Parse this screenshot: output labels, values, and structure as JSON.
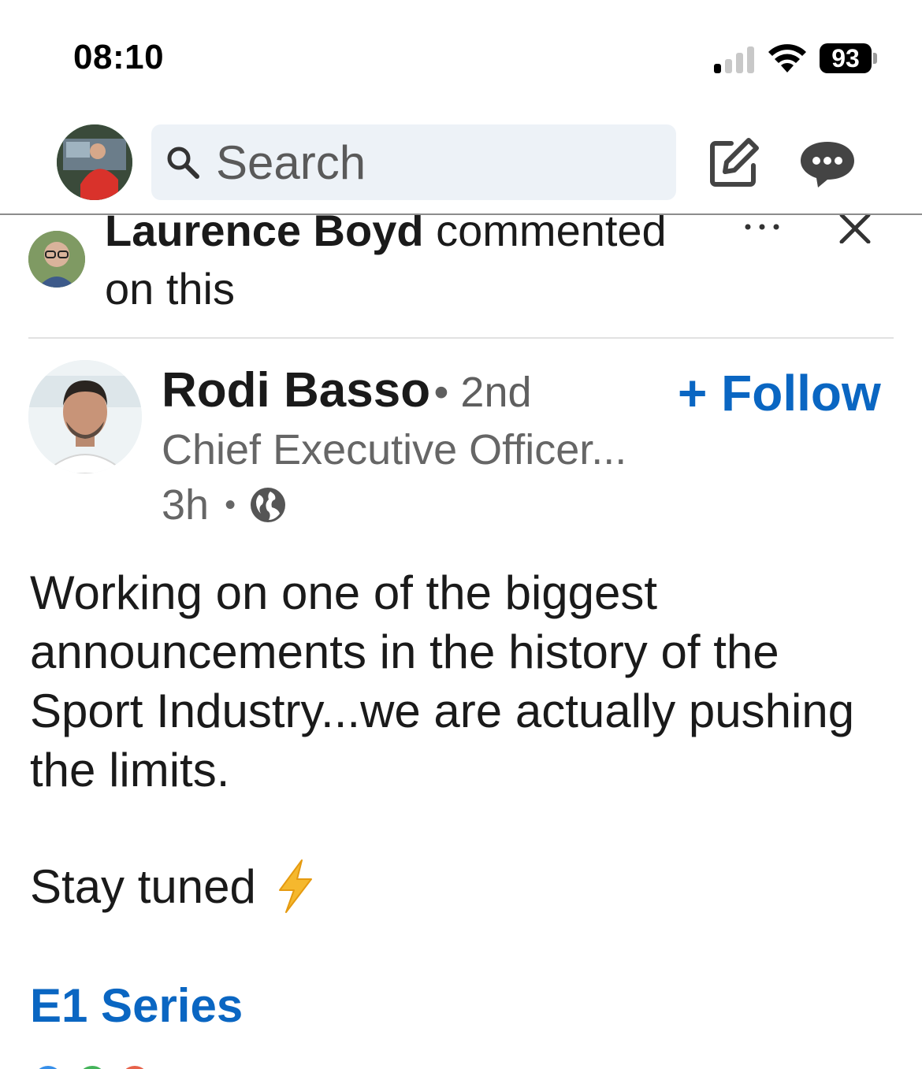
{
  "status_bar": {
    "time": "08:10",
    "battery": "93",
    "icons": [
      "cellular-signal-icon",
      "wifi-icon",
      "battery-icon"
    ]
  },
  "top_bar": {
    "search_placeholder": "Search",
    "icons": [
      "search-icon",
      "compose-icon",
      "messages-icon"
    ]
  },
  "social_context": {
    "actor": "Laurence Boyd",
    "action": "commented",
    "suffix": "on this"
  },
  "post": {
    "author": {
      "name": "Rodi Basso",
      "degree": "• 2nd",
      "headline": "Chief Executive Officer...",
      "time": "3h",
      "separator": "•"
    },
    "follow_label": "+ Follow",
    "body": "Working on one of the biggest announcements in the history of the Sport Industry...we are actually pushing the limits.",
    "stay_tuned": "Stay tuned",
    "hashtag": "E1 Series"
  },
  "colors": {
    "link_blue": "#0a66c2",
    "search_bg": "#edf2f7",
    "bolt": "#f5b82e"
  }
}
